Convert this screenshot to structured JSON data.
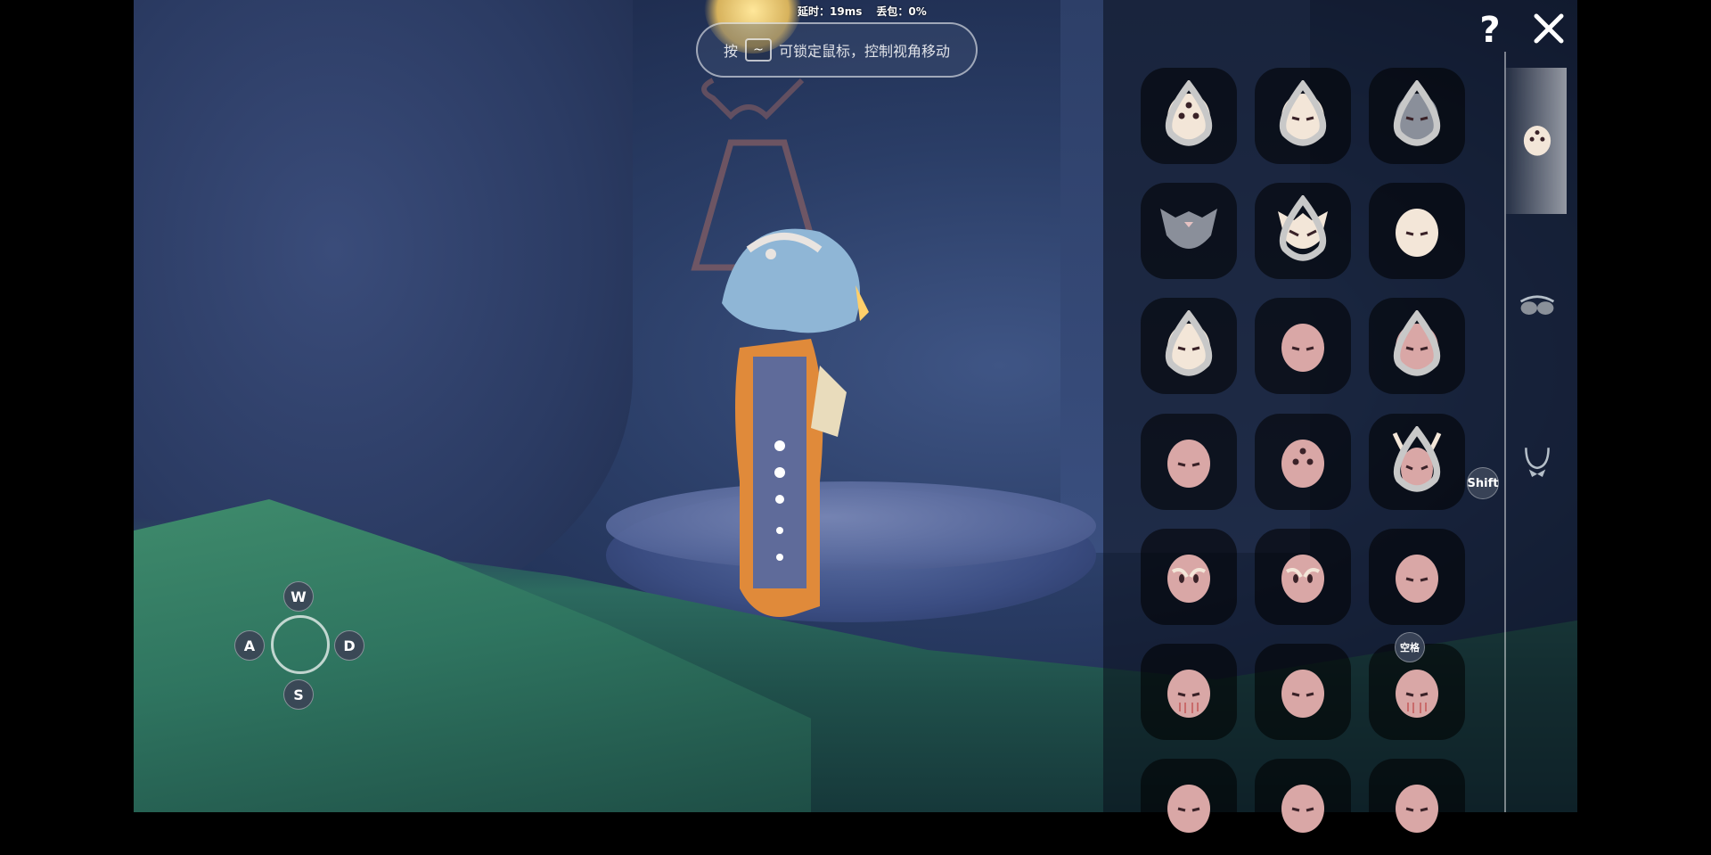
{
  "hud": {
    "latency_label": "延时：19ms",
    "packet_loss_label": "丢包：0%",
    "hint_prefix": "按",
    "hint_key": "~",
    "hint_text": "可锁定鼠标，控制视角移动"
  },
  "movement": {
    "up": "W",
    "left": "A",
    "right": "D",
    "down": "S"
  },
  "closet": {
    "help_label": "?",
    "close_icon": "close-icon",
    "shift_badge": "Shift",
    "empty_badge": "空格",
    "categories": [
      "mask-icon",
      "glasses-icon",
      "necklace-icon"
    ],
    "active_category": 0,
    "masks": [
      {
        "icon": "mask-three-dots-icon",
        "unlock_drop": true
      },
      {
        "icon": "mask-sparkle-sleepy-icon",
        "unlock_drop": true
      },
      {
        "icon": "mask-gray-hood-icon",
        "unlock_drop": true
      },
      {
        "icon": "mask-gray-horned-icon",
        "unlock_drop": false
      },
      {
        "icon": "mask-fox-icon",
        "unlock_drop": true
      },
      {
        "icon": "mask-bun-icon",
        "unlock_drop": false
      },
      {
        "icon": "mask-square-mark-icon",
        "unlock_drop": true
      },
      {
        "icon": "mask-bearded-elder-icon",
        "unlock_drop": false
      },
      {
        "icon": "mask-bearded-full-icon",
        "unlock_drop": true
      },
      {
        "icon": "mask-spiky-cracked-icon",
        "unlock_drop": false
      },
      {
        "icon": "mask-pink-three-dots-icon",
        "unlock_drop": false
      },
      {
        "icon": "mask-horned-white-icon",
        "unlock_drop": true
      },
      {
        "icon": "mask-owl-icon",
        "unlock_drop": false
      },
      {
        "icon": "mask-winged-owl-icon",
        "unlock_drop": false
      },
      {
        "icon": "mask-sleepy-pink-icon",
        "unlock_drop": false
      },
      {
        "icon": "mask-red-stripes-icon",
        "unlock_drop": false
      },
      {
        "icon": "mask-flower-icon",
        "unlock_drop": false
      },
      {
        "icon": "mask-tear-icon",
        "unlock_drop": false
      },
      {
        "icon": "mask-pink-partial-a-icon",
        "unlock_drop": false
      },
      {
        "icon": "mask-pink-partial-b-icon",
        "unlock_drop": false
      },
      {
        "icon": "mask-pink-partial-c-icon",
        "unlock_drop": false
      }
    ]
  },
  "colors": {
    "mask_cream": "#f3e6d8",
    "mask_pink": "#d9a7a6",
    "mask_gray": "#8a8f9a",
    "feature_dark": "#3a2228"
  }
}
